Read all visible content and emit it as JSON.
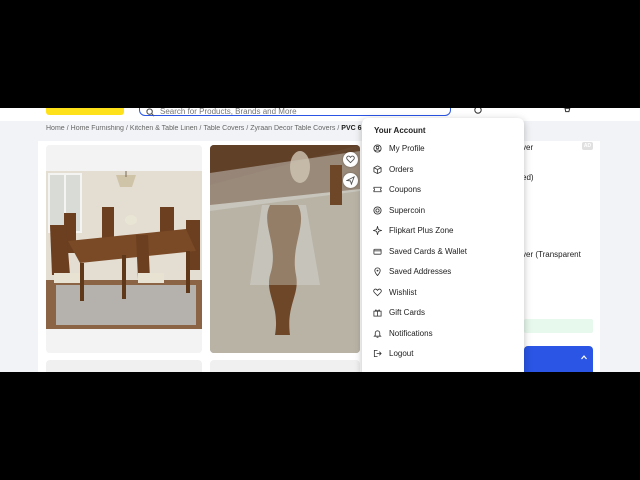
{
  "header": {
    "search_placeholder": "Search for Products, Brands and More"
  },
  "breadcrumb": {
    "items": [
      "Home",
      "Home Furnishing",
      "Kitchen & Table Linen",
      "Table Covers",
      "Zyraan Decor Table Covers"
    ],
    "current": "PVC 6"
  },
  "account_menu": {
    "title": "Your Account",
    "items": [
      {
        "label": "My Profile",
        "icon": "profile-icon"
      },
      {
        "label": "Orders",
        "icon": "orders-icon"
      },
      {
        "label": "Coupons",
        "icon": "coupon-icon"
      },
      {
        "label": "Supercoin",
        "icon": "supercoin-icon"
      },
      {
        "label": "Flipkart Plus Zone",
        "icon": "plus-zone-icon"
      },
      {
        "label": "Saved Cards & Wallet",
        "icon": "card-icon"
      },
      {
        "label": "Saved Addresses",
        "icon": "address-icon"
      },
      {
        "label": "Wishlist",
        "icon": "heart-icon"
      },
      {
        "label": "Gift Cards",
        "icon": "gift-card-icon"
      },
      {
        "label": "Notifications",
        "icon": "bell-icon"
      },
      {
        "label": "Logout",
        "icon": "logout-icon"
      }
    ]
  },
  "right_panel": {
    "line1": "ver",
    "ad_badge": "AD",
    "line2": "ed)",
    "line3": "ver (Transparent"
  },
  "colors": {
    "brand_yellow": "#ffe11b",
    "primary_blue": "#2a55e5",
    "menu_text": "#212121"
  }
}
